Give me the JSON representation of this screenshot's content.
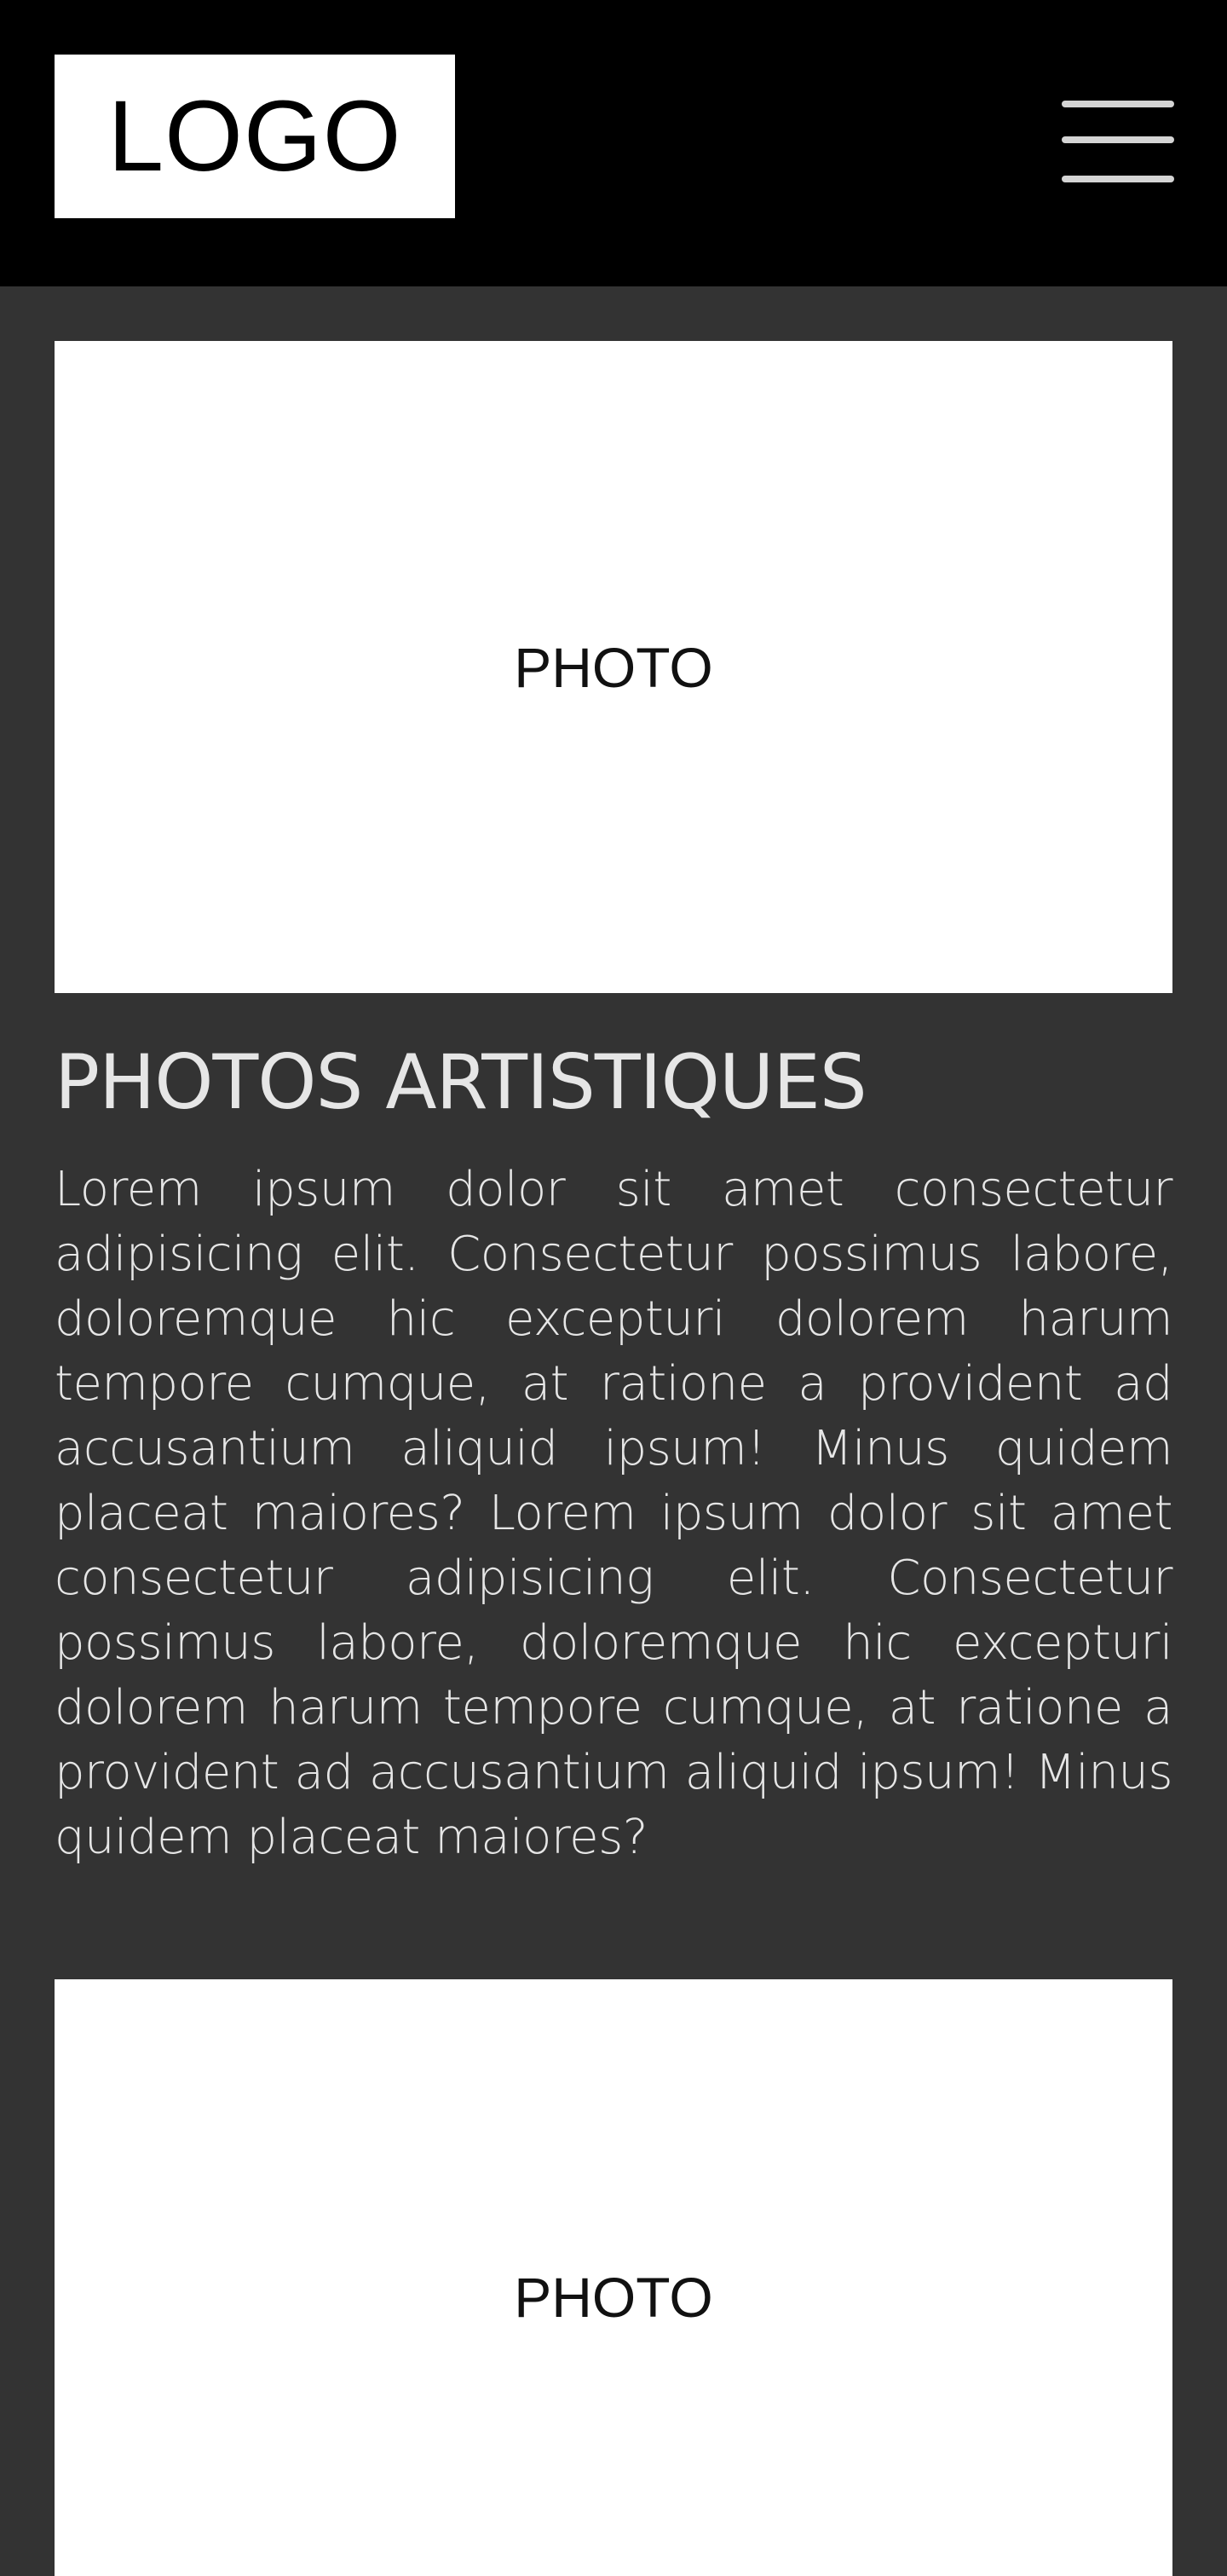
{
  "header": {
    "logo_text": "LOGO",
    "menu_icon": "hamburger-menu-icon"
  },
  "sections": [
    {
      "photo_label": "PHOTO",
      "title": "PHOTOS ARTISTIQUES",
      "text": "Lorem ipsum dolor sit amet consectetur adipisicing elit. Consectetur possimus labore, doloremque hic excepturi dolorem harum tempore cumque, at ratione a provident ad accusantium aliquid ipsum! Minus quidem placeat maiores? Lorem ipsum dolor sit amet consectetur adipisicing elit. Consectetur possimus labore, doloremque hic excepturi dolorem harum tempore cumque, at ratione a provident ad accusantium aliquid ipsum! Minus quidem placeat maiores?"
    },
    {
      "photo_label": "PHOTO"
    }
  ],
  "colors": {
    "header_bg": "#000000",
    "page_bg": "#333333",
    "text": "#e6e6e6",
    "photo_bg": "#ffffff"
  }
}
